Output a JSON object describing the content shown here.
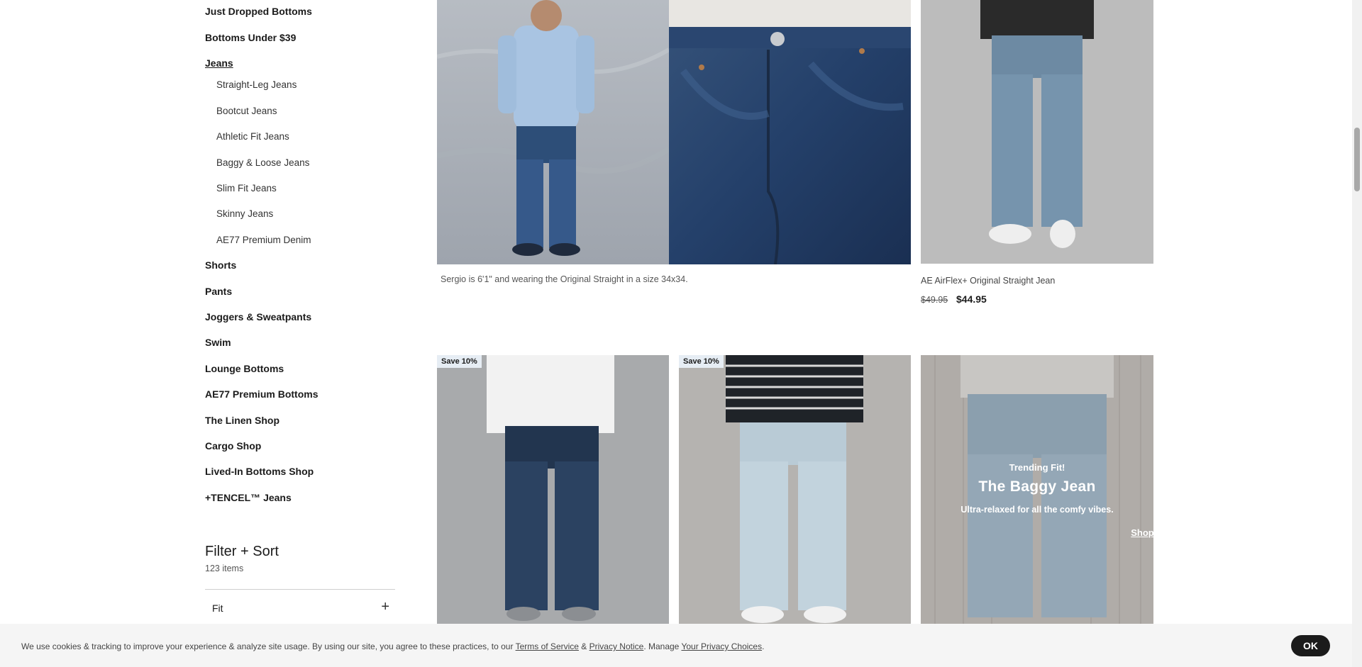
{
  "sidebar": {
    "categories_top": [
      {
        "label": "Just Dropped Bottoms"
      },
      {
        "label": "Bottoms Under $39"
      },
      {
        "label": "Jeans"
      }
    ],
    "jeans_subcategories": [
      {
        "label": "Straight-Leg Jeans"
      },
      {
        "label": "Bootcut Jeans"
      },
      {
        "label": "Athletic Fit Jeans"
      },
      {
        "label": "Baggy & Loose Jeans"
      },
      {
        "label": "Slim Fit Jeans"
      },
      {
        "label": "Skinny Jeans"
      },
      {
        "label": "AE77 Premium Denim"
      }
    ],
    "categories_bottom": [
      {
        "label": "Shorts"
      },
      {
        "label": "Pants"
      },
      {
        "label": "Joggers & Sweatpants"
      },
      {
        "label": "Swim"
      },
      {
        "label": "Lounge Bottoms"
      },
      {
        "label": "AE77 Premium Bottoms"
      },
      {
        "label": "The Linen Shop"
      },
      {
        "label": "Cargo Shop"
      },
      {
        "label": "Lived-In Bottoms Shop"
      },
      {
        "label": "+TENCEL™ Jeans"
      }
    ],
    "filter": {
      "title": "Filter + Sort",
      "count": "123 items",
      "facets": [
        {
          "label": "Fit",
          "toggle_icon": "+"
        }
      ]
    }
  },
  "products": {
    "feature_caption": "Sergio is 6'1\" and wearing the Original Straight in a size 34x34.",
    "item1": {
      "name": "AE AirFlex+ Original Straight Jean",
      "price_original": "$49.95",
      "price_sale": "$44.95"
    },
    "row2": [
      {
        "badge": "Save 10%"
      },
      {
        "badge": "Save 10%"
      }
    ],
    "promo": {
      "kicker": "Trending Fit!",
      "title": "The Baggy Jean",
      "subtitle": "Ultra-relaxed for all the comfy vibes.",
      "link": "Shop Now"
    }
  },
  "cookie": {
    "text_before": "We use cookies & tracking to improve your experience & analyze site usage. By using our site, you agree to these practices, to our ",
    "terms": "Terms of Service",
    "amp": " & ",
    "privacy": "Privacy Notice",
    "manage": ". Manage ",
    "choices": "Your Privacy Choices",
    "end": ".",
    "ok": "OK"
  },
  "colors": {
    "text": "#1b1b1b",
    "badge_bg": "#e6edf4",
    "cookie_bg": "#f5f5f5",
    "button_bg": "#1b1b1b"
  }
}
